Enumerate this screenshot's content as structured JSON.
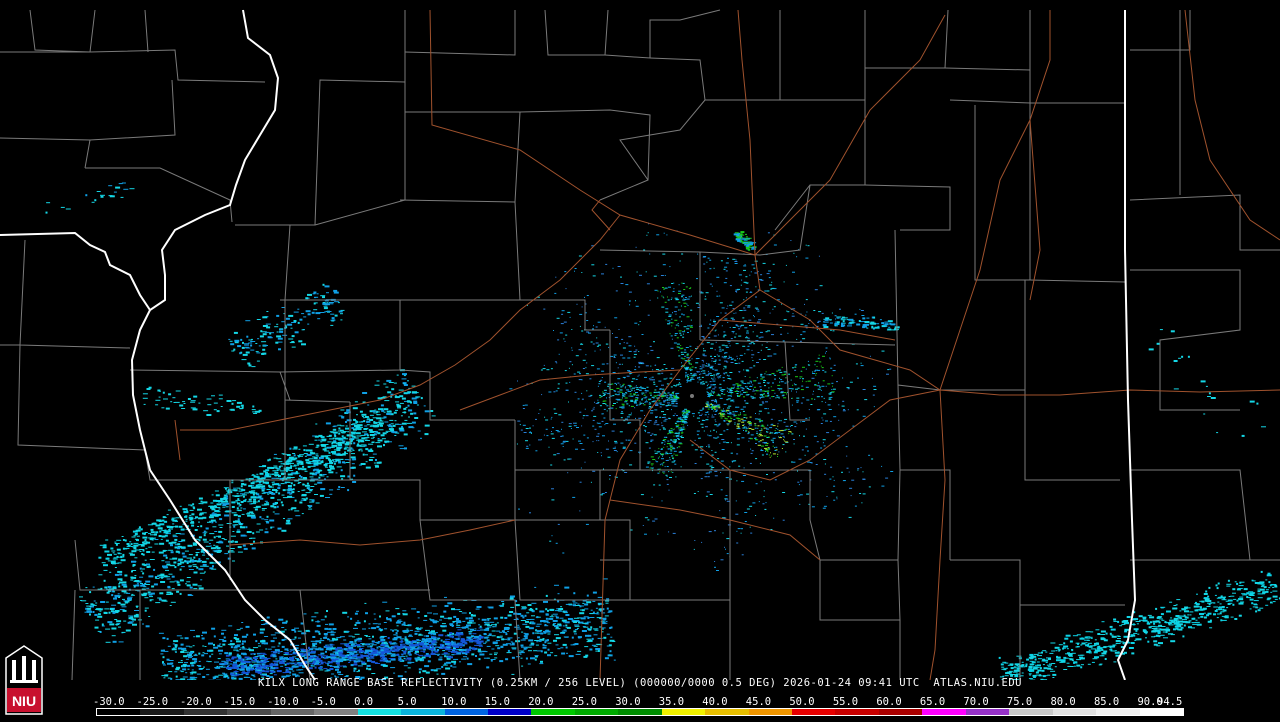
{
  "product_caption": "KILX LONG RANGE BASE REFLECTIVITY (0.25KM / 256 LEVEL) (000000/0000 0.5 DEG) 2026-01-24 09:41 UTC  ATLAS.NIU.EDU",
  "logo": {
    "text": "NIU",
    "colors": {
      "red": "#c8102e",
      "white": "#ffffff",
      "black": "#000000"
    }
  },
  "scale": {
    "labels": [
      "-30.0",
      "-25.0",
      "-20.0",
      "-15.0",
      "-10.0",
      "-5.0",
      "0.0",
      "5.0",
      "10.0",
      "15.0",
      "20.0",
      "25.0",
      "30.0",
      "35.0",
      "40.0",
      "45.0",
      "50.0",
      "55.0",
      "60.0",
      "65.0",
      "70.0",
      "75.0",
      "80.0",
      "85.0",
      "90.0",
      "94.5"
    ],
    "colors": [
      "#000000",
      "#1a1a1a",
      "#333333",
      "#4d4d4d",
      "#666666",
      "#808080",
      "#14e1e1",
      "#0ab4dc",
      "#0064e1",
      "#0000c8",
      "#00c800",
      "#00aa00",
      "#008c00",
      "#f0f000",
      "#e6be00",
      "#f09600",
      "#e60000",
      "#c80000",
      "#aa0000",
      "#ff00ff",
      "#9632c8",
      "#c8c8c8",
      "#e0e0e0",
      "#f0f0f0",
      "#ffffff"
    ]
  },
  "colors": {
    "background": "#000000",
    "county_lines": "#7a7a7a",
    "state_lines": "#ffffff",
    "roads": "#a0522d",
    "echo_light": "#14d7e6",
    "echo_mid": "#0fa0e6",
    "echo_heavy": "#1455d7",
    "echo_green": "#19c819"
  }
}
